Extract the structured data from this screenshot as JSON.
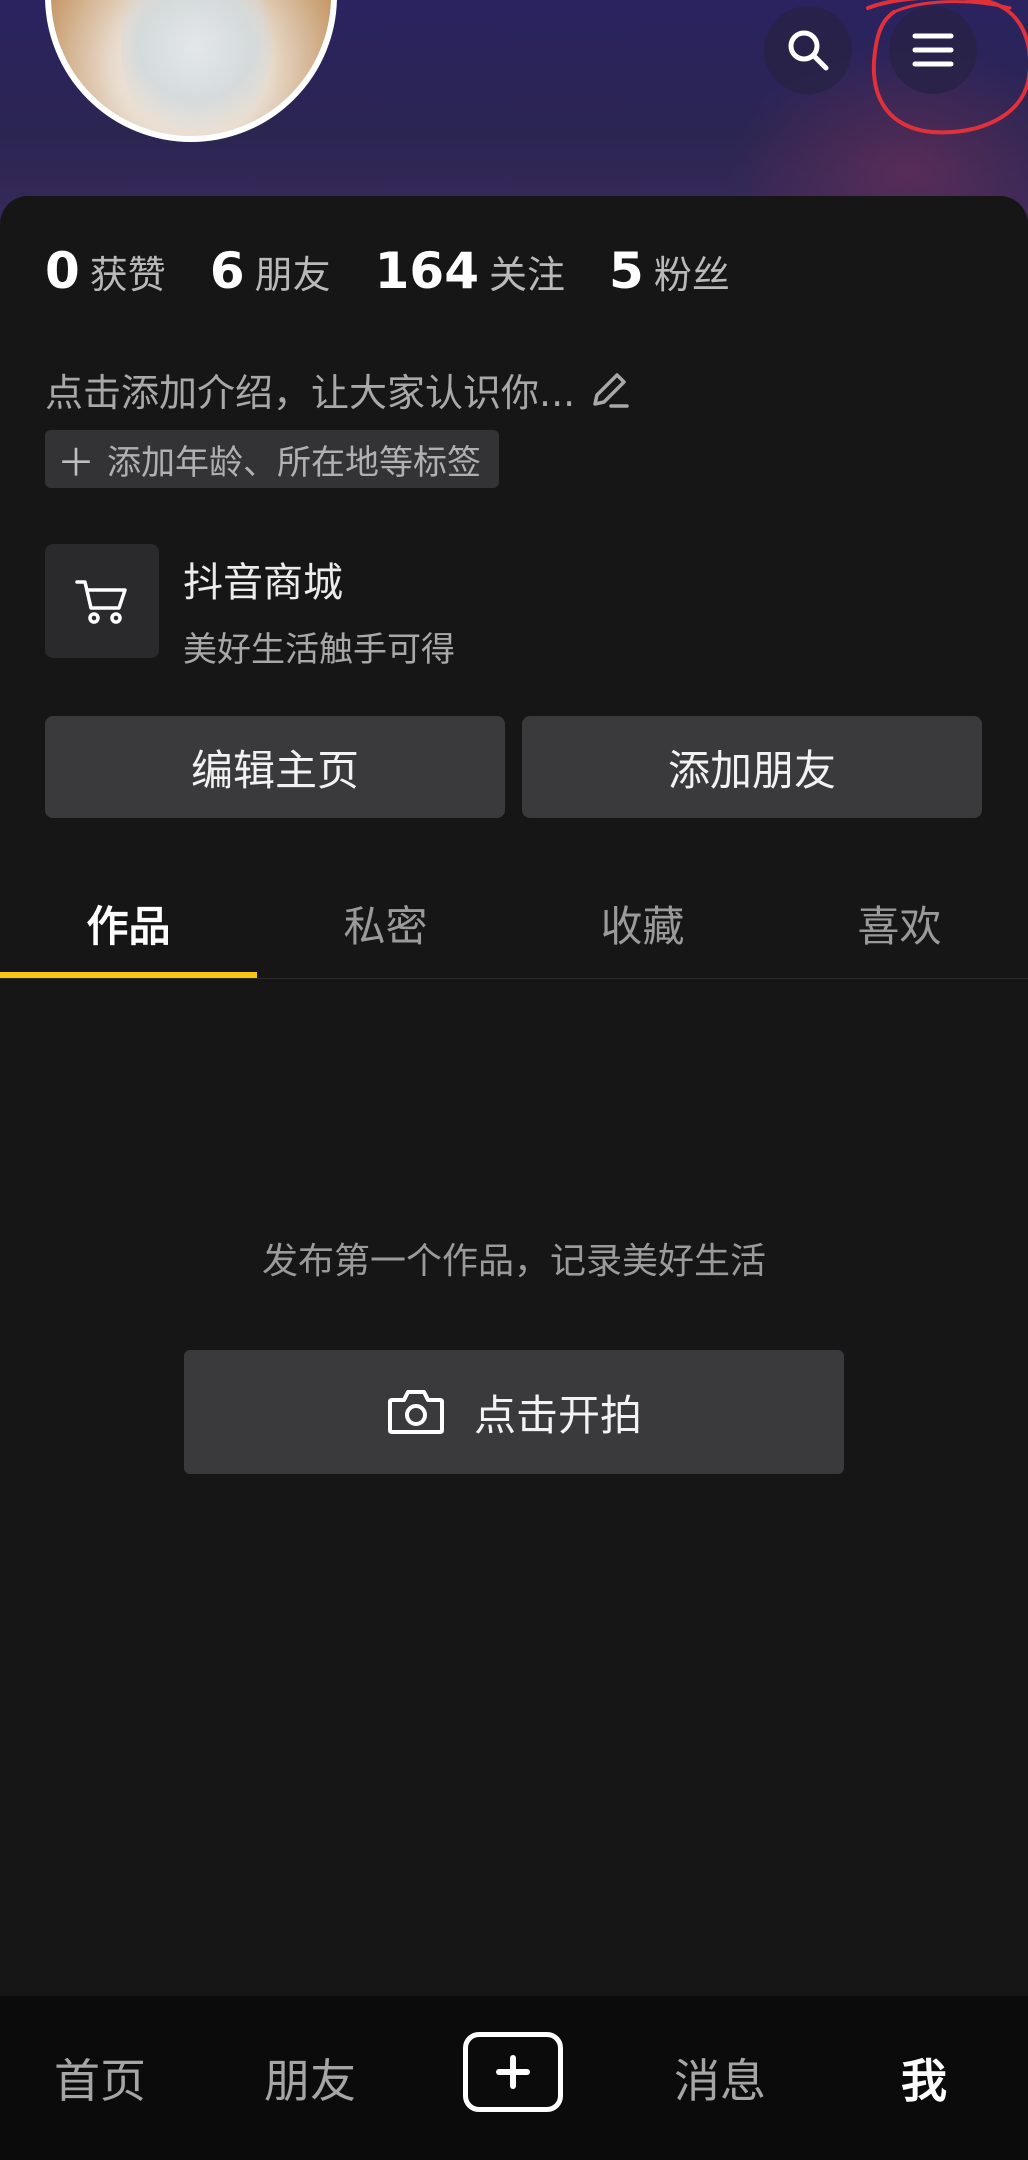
{
  "stats": [
    {
      "num": "0",
      "label": "获赞"
    },
    {
      "num": "6",
      "label": "朋友"
    },
    {
      "num": "164",
      "label": "关注"
    },
    {
      "num": "5",
      "label": "粉丝"
    }
  ],
  "profile": {
    "bio_placeholder": "点击添加介绍，让大家认识你...",
    "tag_chip": "添加年龄、所在地等标签"
  },
  "shop": {
    "title": "抖音商城",
    "subtitle": "美好生活触手可得"
  },
  "actions": {
    "edit": "编辑主页",
    "add_friend": "添加朋友"
  },
  "tabs": [
    "作品",
    "私密",
    "收藏",
    "喜欢"
  ],
  "empty": {
    "message": "发布第一个作品，记录美好生活",
    "shoot_label": "点击开拍"
  },
  "bottom_nav": [
    "首页",
    "朋友",
    "消息",
    "我"
  ],
  "colors": {
    "accent": "#f5c518",
    "background": "#161616",
    "annotation": "#e0303a"
  },
  "icons": {
    "search": "search-icon",
    "menu": "menu-icon",
    "cart": "cart-icon",
    "edit": "pencil-icon",
    "camera": "camera-icon",
    "create": "plus-icon"
  }
}
